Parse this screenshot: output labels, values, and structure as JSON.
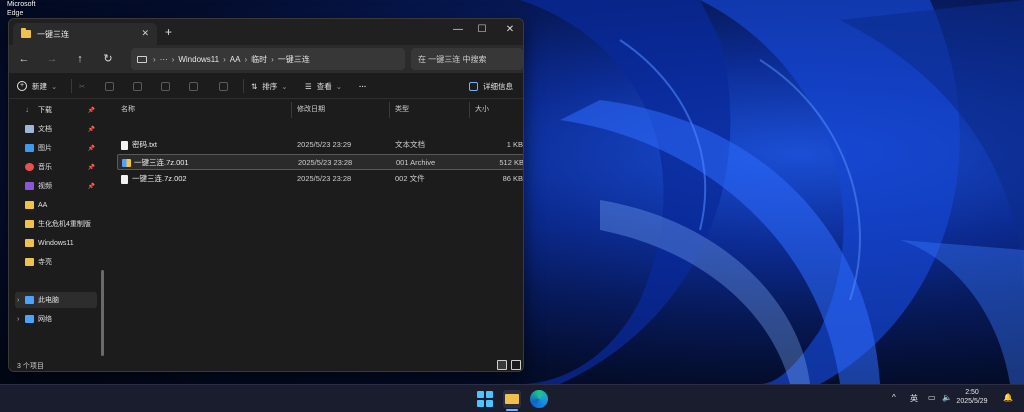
{
  "desktop": {
    "edge_label": "Microsoft Edge"
  },
  "window": {
    "tab_title": "一键三连",
    "new_tab": "+",
    "controls": {
      "minimize": "—",
      "maximize": "☐",
      "close": "✕"
    },
    "nav": {
      "back": "←",
      "forward": "→",
      "up": "↑",
      "refresh": "↻"
    },
    "breadcrumb": [
      "Windows11",
      "AA",
      "临时",
      "一键三连"
    ],
    "breadcrumb_more": "···",
    "search_placeholder": "在 一键三连 中搜索",
    "toolbar": {
      "new_label": "新建",
      "sort_label": "排序",
      "view_label": "查看",
      "more_label": "···",
      "details_label": "详细信息"
    },
    "sidebar": {
      "quick_access": [
        {
          "label": "下载",
          "icon": "download-icon",
          "pinned": true
        },
        {
          "label": "文档",
          "icon": "document-icon",
          "pinned": true
        },
        {
          "label": "图片",
          "icon": "picture-icon",
          "pinned": true
        },
        {
          "label": "音乐",
          "icon": "music-icon",
          "pinned": true
        },
        {
          "label": "视频",
          "icon": "video-icon",
          "pinned": true
        },
        {
          "label": "AA",
          "icon": "folder-icon",
          "pinned": false
        },
        {
          "label": "生化危机4重制版",
          "icon": "folder-icon",
          "pinned": false
        },
        {
          "label": "Windows11",
          "icon": "folder-icon",
          "pinned": false
        },
        {
          "label": "寺亮",
          "icon": "folder-icon",
          "pinned": false
        }
      ],
      "this_pc": "此电脑",
      "network": "网络"
    },
    "columns": {
      "name": "名称",
      "date": "修改日期",
      "type": "类型",
      "size": "大小"
    },
    "files": [
      {
        "name": "密码.txt",
        "date": "2025/5/23 23:29",
        "type": "文本文档",
        "size": "1 KB",
        "icon": "text-file-icon"
      },
      {
        "name": "一键三连.7z.001",
        "date": "2025/5/23 23:28",
        "type": "001 Archive",
        "size": "512 KB",
        "icon": "archive-icon"
      },
      {
        "name": "一键三连.7z.002",
        "date": "2025/5/23 23:28",
        "type": "002 文件",
        "size": "86 KB",
        "icon": "file-icon"
      }
    ],
    "status_text": "3 个项目"
  },
  "taskbar": {
    "lang": "英",
    "time": "2:50",
    "date": "2025/5/29"
  }
}
